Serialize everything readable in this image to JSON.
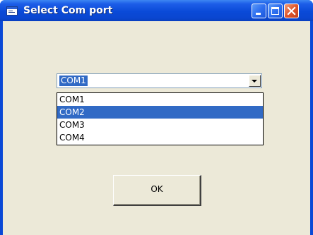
{
  "window": {
    "title": "Select Com port",
    "icon": "app-window-icon",
    "controls": [
      "minimize-icon",
      "maximize-icon",
      "close-icon"
    ]
  },
  "combo": {
    "selected_value": "COM1",
    "options": [
      "COM1",
      "COM2",
      "COM3",
      "COM4"
    ],
    "highlighted_index": 1
  },
  "ok_button": {
    "label": "OK"
  },
  "colors": {
    "titlebar": "#0a4ad8",
    "client_background": "#ece9d8",
    "selection": "#316ac5",
    "close_button": "#e0552c"
  }
}
